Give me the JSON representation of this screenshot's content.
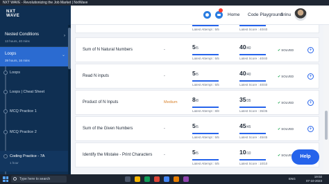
{
  "browser": {
    "title": "NXT WAVE - Revolutionizing the Job Market | NxtWave"
  },
  "header": {
    "logo_line1": "NXT",
    "logo_line2": "WAVE",
    "home_label": "Home",
    "playground_label": "Code Playground",
    "user_label": "Srinu"
  },
  "sidebar": {
    "sections": [
      {
        "title": "Nested Conditions",
        "sub": "13 hours, 40 mins",
        "chevron": "›"
      },
      {
        "title": "Loops",
        "sub": "39 hours, 16 mins",
        "chevron": "⌄"
      }
    ],
    "children": [
      {
        "title": "Loops",
        "sub": ""
      },
      {
        "title": "Loops | Cheat Sheet",
        "sub": ""
      },
      {
        "title": "MCQ Practice 1",
        "sub": ""
      },
      {
        "title": "MCQ Practice 2",
        "sub": ""
      },
      {
        "title": "Coding Practice - 7A",
        "sub": "1 hour"
      }
    ]
  },
  "problems": [
    {
      "name": "",
      "difficulty": "",
      "attempt": "",
      "attempt_total": "",
      "attempt_frac": 1,
      "attempt_note": "Latest Attempt : 5/5",
      "score": "",
      "score_total": "",
      "score_frac": 1,
      "score_note": "Latest Score : 40/40",
      "status": ""
    },
    {
      "name": "Sum of N Natural Numbers",
      "difficulty": "-",
      "attempt": "5",
      "attempt_total": "/5",
      "attempt_frac": 1,
      "attempt_note": "Latest Attempt : 5/5",
      "score": "40",
      "score_total": "/40",
      "score_frac": 1,
      "score_note": "Latest Score : 40/40",
      "status": "SOLVED"
    },
    {
      "name": "Read N inputs",
      "difficulty": "-",
      "attempt": "5",
      "attempt_total": "/5",
      "attempt_frac": 1,
      "attempt_note": "Latest Attempt : 5/5",
      "score": "40",
      "score_total": "/40",
      "score_frac": 1,
      "score_note": "Latest Score : 40/40",
      "status": "SOLVED"
    },
    {
      "name": "Product of N Inputs",
      "difficulty": "Medium",
      "attempt": "8",
      "attempt_total": "/8",
      "attempt_frac": 1,
      "attempt_note": "Latest Attempt : 8/8",
      "score": "35",
      "score_total": "/35",
      "score_frac": 1,
      "score_note": "Latest Score : 35/35",
      "status": "SOLVED"
    },
    {
      "name": "Sum of the Given Numbers",
      "difficulty": "-",
      "attempt": "5",
      "attempt_total": "/5",
      "attempt_frac": 1,
      "attempt_note": "Latest Attempt : 5/5",
      "score": "45",
      "score_total": "/45",
      "score_frac": 1,
      "score_note": "Latest Score : 45/45",
      "status": "SOLVED"
    },
    {
      "name": "Identify the Mistake - Print Characters",
      "difficulty": "-",
      "attempt": "5",
      "attempt_total": "/5",
      "attempt_frac": 1,
      "attempt_note": "Latest Attempt : 5/5",
      "score": "10",
      "score_total": "/10",
      "score_frac": 1,
      "score_note": "Latest Score : 10/10",
      "status": "SOLVED"
    }
  ],
  "help_label": "Help",
  "taskbar": {
    "search_placeholder": "Type here to search",
    "lang": "ENG",
    "time": "19:02",
    "date": "07-10-2023"
  },
  "colors": {
    "brand": "#0f2f52",
    "accent": "#2563eb",
    "medium": "#d9822b",
    "solved": "#16a34a"
  }
}
